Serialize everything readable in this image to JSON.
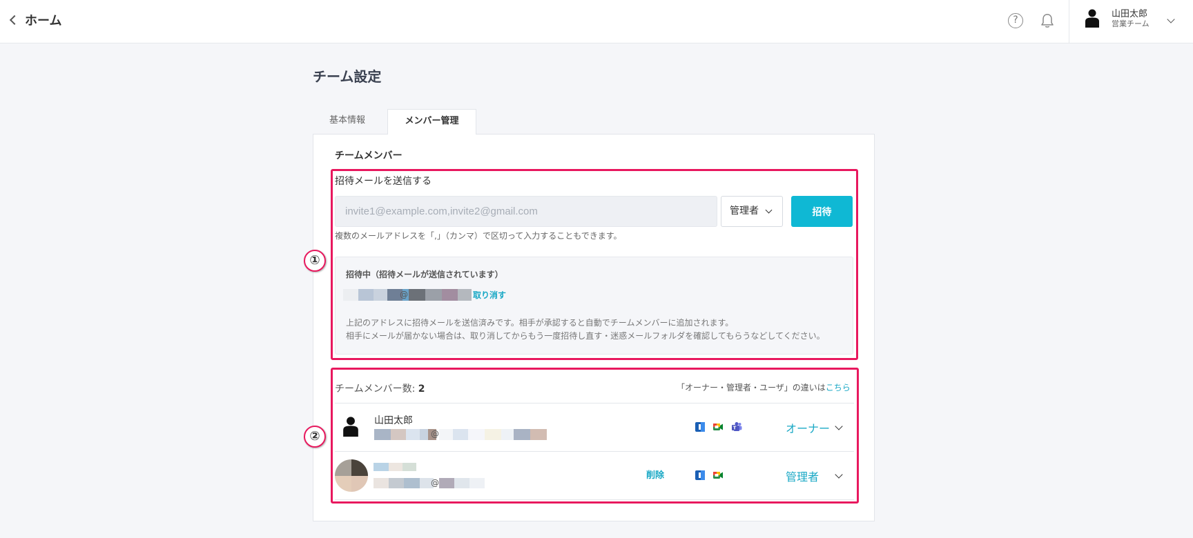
{
  "header": {
    "back_label": "ホーム",
    "user_name": "山田太郎",
    "user_team": "営業チーム"
  },
  "page": {
    "title": "チーム設定",
    "tabs": [
      {
        "label": "基本情報",
        "active": false
      },
      {
        "label": "メンバー管理",
        "active": true
      }
    ],
    "section_title": "チームメンバー"
  },
  "invite": {
    "label": "招待メールを送信する",
    "placeholder": "invite1@example.com,invite2@gmail.com",
    "role_selected": "管理者",
    "button_label": "招待",
    "hint": "複数のメールアドレスを「,」（カンマ）で区切って入力することもできます。"
  },
  "pending": {
    "title": "招待中（招待メールが送信されています）",
    "email_at": "@",
    "cancel_label": "取り消す",
    "note_line1": "上記のアドレスに招待メールを送信済みです。相手が承認すると自動でチームメンバーに追加されます。",
    "note_line2": "相手にメールが届かない場合は、取り消してからもう一度招待し直す・迷惑メールフォルダを確認してもらうなどしてください。"
  },
  "members": {
    "count_label": "チームメンバー数: ",
    "count": "2",
    "diff_text": "「オーナー・管理者・ユーザ」の違いは",
    "diff_link": "こちら",
    "list": [
      {
        "name": "山田太郎",
        "email_at": "@",
        "role": "オーナー",
        "services": [
          "calendar-icon",
          "meet-icon",
          "teams-icon"
        ]
      },
      {
        "email_at": "@",
        "role": "管理者",
        "delete_label": "削除",
        "services": [
          "calendar-icon",
          "meet-icon"
        ]
      }
    ]
  },
  "annotations": {
    "marker1": "①",
    "marker2": "②"
  },
  "colors": {
    "accent": "#0fb8d4",
    "link": "#19a8c5",
    "highlight": "#e8185e"
  }
}
